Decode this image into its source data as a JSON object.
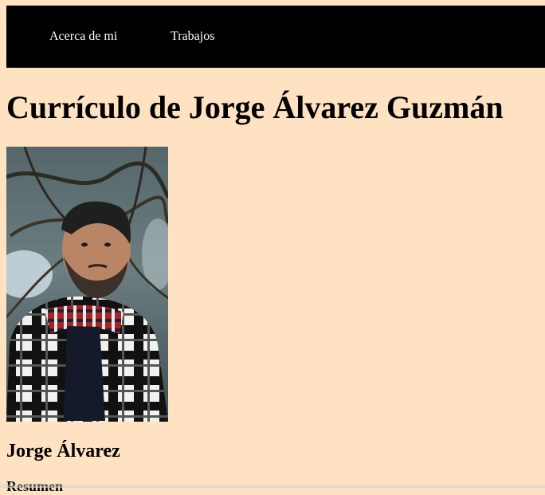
{
  "nav": {
    "items": [
      {
        "label": "Acerca de mi"
      },
      {
        "label": "Trabajos"
      }
    ]
  },
  "page": {
    "title": "Currículo de Jorge Álvarez Guzmán"
  },
  "profile": {
    "name": "Jorge Álvarez",
    "summary_heading": "Resumen"
  },
  "colors": {
    "background": "#ffe2c2",
    "nav_background": "#000000",
    "nav_text": "#ffffff"
  }
}
